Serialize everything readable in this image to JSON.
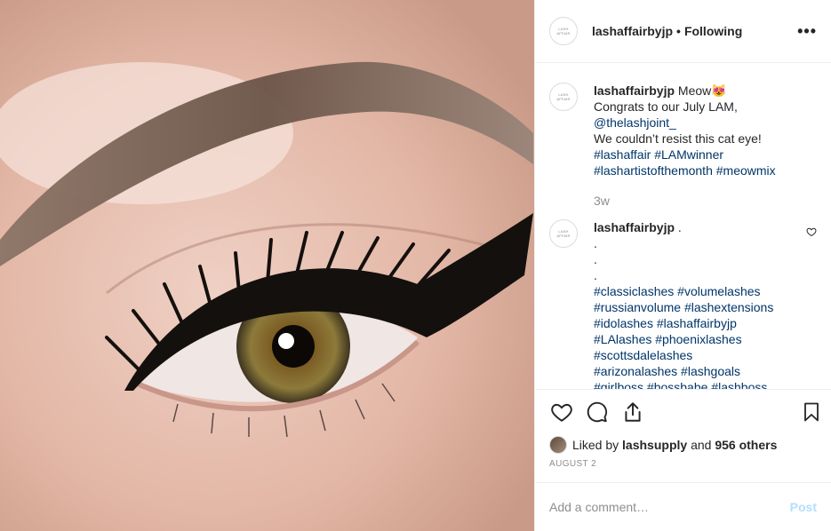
{
  "header": {
    "avatar_text": "LASH AFFAIR",
    "username": "lashaffairbyjp",
    "separator": "•",
    "follow_status": "Following",
    "more": "•••"
  },
  "caption": {
    "username": "lashaffairbyjp",
    "lines": [
      {
        "text": "Meow",
        "emoji": "😻"
      },
      {
        "text": "Congrats to our July LAM,"
      },
      {
        "mention": "@thelashjoint_"
      },
      {
        "text": "We couldn’t resist this cat eye!"
      }
    ],
    "line1": "Meow",
    "emoji": "😻",
    "line2": "Congrats to our July LAM,",
    "mention": "@thelashjoint_",
    "line4": "We couldn’t resist this cat eye!",
    "tags_line1": "#lashaffair #LAMwinner",
    "tags_line2": "#lashartistofthemonth #meowmix",
    "age": "3w"
  },
  "comment": {
    "username": "lashaffairbyjp",
    "first": ".",
    "dot1": ".",
    "dot2": ".",
    "dot3": ".",
    "tags": [
      "#classiclashes #volumelashes",
      "#russianvolume #lashextensions",
      "#idolashes #lashaffairbyjp",
      "#LAlashes #phoenixlashes",
      "#scottsdalelashes",
      "#arizonalashes #lashgoals",
      "#girlboss #bossbabe #lashboss"
    ]
  },
  "likes": {
    "prefix": "Liked by",
    "user": "lashsupply",
    "joiner": "and",
    "others": "956 others"
  },
  "date": "AUGUST 2",
  "add_comment": {
    "placeholder": "Add a comment…",
    "post_label": "Post"
  },
  "icons": {
    "like": "heart-icon",
    "comment": "comment-bubble-icon",
    "share": "share-icon",
    "save": "bookmark-icon",
    "comment_like": "small-heart-icon"
  },
  "colors": {
    "link": "#003569",
    "muted": "#8e8e8e",
    "post_disabled": "#b2dffc",
    "text": "#262626"
  }
}
